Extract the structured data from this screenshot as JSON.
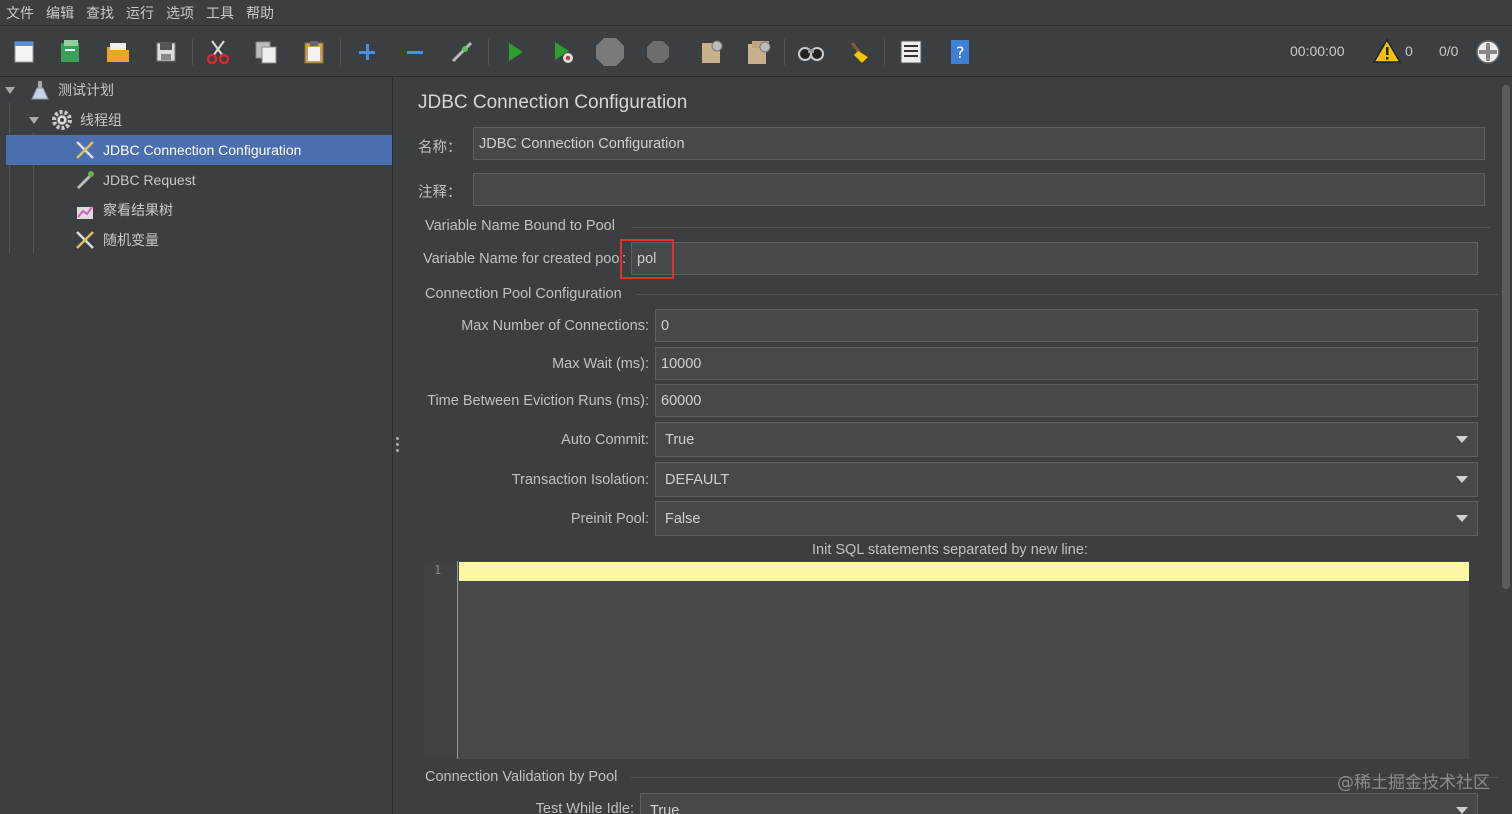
{
  "menu": [
    "文件",
    "编辑",
    "查找",
    "运行",
    "选项",
    "工具",
    "帮助"
  ],
  "toolbar": {
    "icons": [
      "new-icon",
      "templates-icon",
      "open-icon",
      "save-icon",
      "cut-icon",
      "copy-icon",
      "paste-icon",
      "expand-icon",
      "collapse-icon",
      "toggle-icon",
      "start-icon",
      "start-no-pause-icon",
      "stop-icon",
      "shutdown-icon",
      "clear-icon",
      "clear-all-icon",
      "search-icon",
      "reset-search-icon",
      "function-helper-icon",
      "help-icon"
    ],
    "timer": "00:00:00",
    "warning_count": "0",
    "threads": "0/0",
    "colors": {
      "run": "#2e9e2e",
      "warning": "#f5c400",
      "cut": "#d62a2a"
    }
  },
  "tree": {
    "items": [
      {
        "label": "测试计划",
        "icon": "flask-icon",
        "expanded": true
      },
      {
        "label": "线程组",
        "icon": "gear-icon",
        "expanded": true
      },
      {
        "label": "JDBC Connection Configuration",
        "icon": "wrench-icon",
        "selected": true
      },
      {
        "label": "JDBC Request",
        "icon": "pipette-icon"
      },
      {
        "label": "察看结果树",
        "icon": "chart-icon"
      },
      {
        "label": "随机变量",
        "icon": "wrench-icon"
      }
    ],
    "selected_color": "#4b6eaf"
  },
  "panel": {
    "title": "JDBC Connection Configuration",
    "name_label": "名称：",
    "name_value": "JDBC Connection Configuration",
    "comment_label": "注释：",
    "comment_value": "",
    "group_pool": "Variable Name Bound to Pool",
    "var_label": "Variable Name for created poo",
    "var_colon": ":",
    "var_value": "pol",
    "group_conn": "Connection Pool Configuration",
    "max_conn_label": "Max Number of Connections:",
    "max_conn_value": "0",
    "max_wait_label": "Max Wait (ms):",
    "max_wait_value": "10000",
    "eviction_label": "Time Between Eviction Runs (ms):",
    "eviction_value": "60000",
    "auto_commit_label": "Auto Commit:",
    "auto_commit_value": "True",
    "isolation_label": "Transaction Isolation:",
    "isolation_value": "DEFAULT",
    "preinit_label": "Preinit Pool:",
    "preinit_value": "False",
    "init_sql_label": "Init SQL statements separated by new line:",
    "init_sql_line_no": "1",
    "group_validation": "Connection Validation by Pool",
    "test_idle_label": "Test While Idle:",
    "test_idle_value": "True"
  },
  "watermark": "@稀土掘金技术社区",
  "highlight_color": "#e03030"
}
